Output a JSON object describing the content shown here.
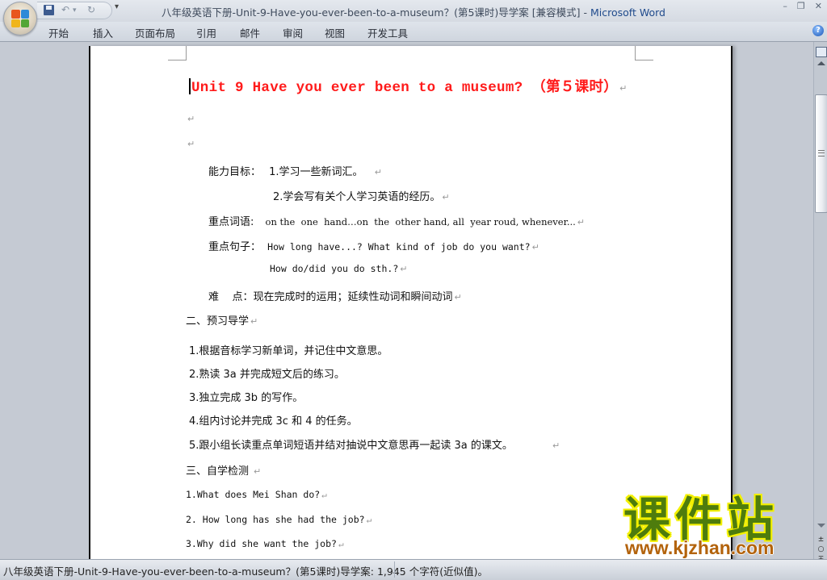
{
  "window": {
    "title_doc": "八年级英语下册-Unit-9-Have-you-ever-been-to-a-museum？(第5课时)导学案 [兼容模式]",
    "title_sep": " - ",
    "title_app": "Microsoft Word",
    "controls": {
      "minimize": "–",
      "restore": "❐",
      "close": "✕"
    }
  },
  "quick_access": {
    "save_icon": "save-icon",
    "undo": "↶",
    "undo_dropdown": "▾",
    "redo": "↻",
    "customize": "▾"
  },
  "ribbon": {
    "tabs": [
      {
        "label": "开始"
      },
      {
        "label": "插入"
      },
      {
        "label": "页面布局"
      },
      {
        "label": "引用"
      },
      {
        "label": "邮件"
      },
      {
        "label": "审阅"
      },
      {
        "label": "视图"
      },
      {
        "label": "开发工具"
      }
    ],
    "help": "?"
  },
  "document": {
    "heading": "Unit 9 Have you ever been to a museum? （第５课时）",
    "para_mark": "↵",
    "goals": {
      "ability_label": "能力目标：",
      "ability_1": "1.学习一些新词汇。",
      "ability_2": "2.学会写有关个人学习英语的经历。",
      "words_label": "重点词语:",
      "words": "on the  one  hand…on  the  other hand, all  year roud, whenever...",
      "sentences_label": "重点句子：",
      "sentence_1": "How long have...? What kind of job do you want?",
      "sentence_2": "How do/did you do sth.?",
      "difficulty_label": "难    点：",
      "difficulty": "现在完成时的运用；延续性动词和瞬间动词"
    },
    "section2": {
      "title": "二、预习导学",
      "items": [
        "1.根据音标学习新单词，并记住中文意思。",
        "2.熟读 3a 并完成短文后的练习。",
        "3.独立完成 3b 的写作。",
        "4.组内讨论并完成 3c 和 4 的任务。",
        "5.跟小组长读重点单词短语并结对抽说中文意思再一起读 3a 的课文。"
      ]
    },
    "section3": {
      "title": "三、自学检测",
      "items": [
        "1.What does Mei Shan do?",
        "2. How long has she had the job?",
        "3.Why did she want the job?"
      ]
    }
  },
  "scrollbar": {
    "prev_page": "±",
    "select_browse": "○",
    "next_page": "∓"
  },
  "statusbar": {
    "text": "八年级英语下册-Unit-9-Have-you-ever-been-to-a-museum？(第5课时)导学案: 1,945 个字符(近似值)。"
  },
  "watermark": {
    "cn": "课件站",
    "url": "www.kjzhan.com"
  },
  "colors": {
    "heading": "#ff1a1a",
    "watermark_green": "#4e7c0d",
    "watermark_outline": "#f3f000",
    "watermark_url": "#b3630c",
    "app_title": "#1f4a8c"
  }
}
